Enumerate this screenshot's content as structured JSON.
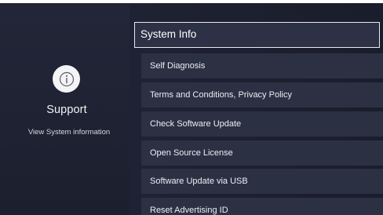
{
  "left_panel": {
    "icon": "info-circle-icon",
    "title": "Support",
    "subtitle": "View System information"
  },
  "menu": {
    "header": "System Info",
    "items": [
      {
        "label": "Self Diagnosis"
      },
      {
        "label": "Terms and Conditions, Privacy Policy"
      },
      {
        "label": "Check Software Update"
      },
      {
        "label": "Open Source License"
      },
      {
        "label": "Software Update via USB"
      },
      {
        "label": "Reset Advertising ID"
      }
    ]
  },
  "colors": {
    "background": "#1c1f2e",
    "item_background": "#2c3043",
    "focus_border": "#e8e9ee"
  }
}
